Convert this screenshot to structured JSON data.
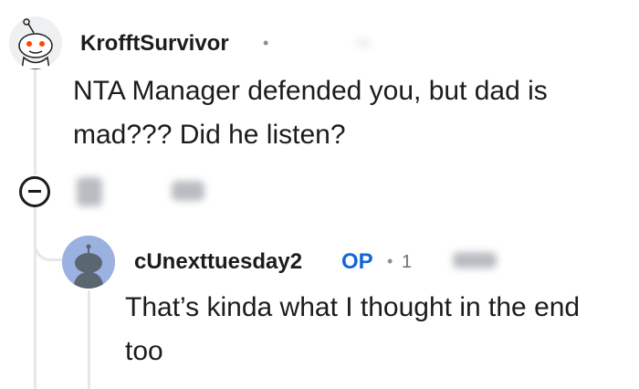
{
  "comment": {
    "username": "KrofftSurvivor",
    "separator": "•",
    "body_line1": "NTA Manager defended you, but dad is",
    "body_line2": "mad??? Did he listen?"
  },
  "reply": {
    "username": "cUnexttuesday2",
    "op_badge": "OP",
    "separator": "•",
    "partial_time": "1",
    "body_line1": "That’s kinda what I thought in the end",
    "body_line2": "too"
  },
  "icons": {
    "collapse": "collapse-minus-icon",
    "comment_avatar": "reddit-snoo-avatar-icon",
    "reply_avatar": "default-user-avatar-icon"
  },
  "colors": {
    "op": "#1565d8",
    "thread_line": "#e5e7ea",
    "reply_avatar_bg": "#9bb1e0"
  }
}
